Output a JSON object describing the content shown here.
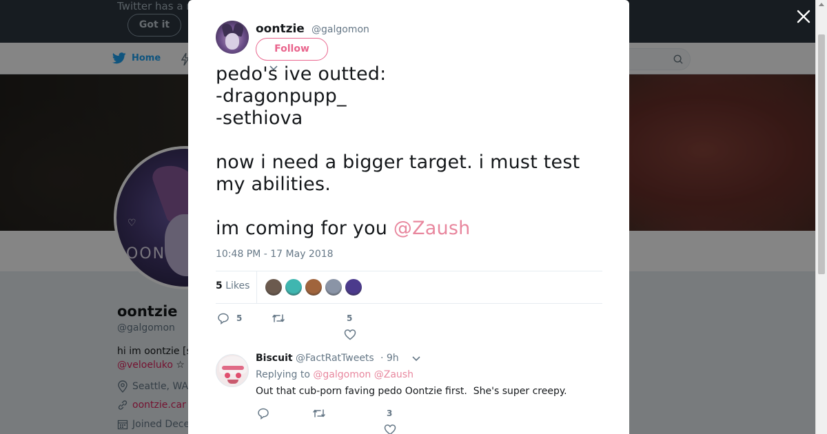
{
  "background": {
    "notice_text": "Twitter has a n",
    "got_it_label": "Got it",
    "nav_home_label": "Home",
    "profile": {
      "name": "oontzie",
      "handle": "@galgomon",
      "bio_line1": "hi im oontzie [s",
      "bio_link": "@veloeluko",
      "bio_star": " ☆ ",
      "location": "Seattle, WA",
      "website": "oontzie.car",
      "joined": "Joined Dece",
      "avatar_text": "OON"
    },
    "avatar_heart": "♡"
  },
  "modal": {
    "author": {
      "name": "oontzie",
      "handle": "@galgomon",
      "follow_label": "Follow"
    },
    "tweet": {
      "text_main": "pedo's ive outted:\n-dragonpupp_\n-sethiova\n\nnow i need a bigger target. i must test\nmy abilities.\n\nim coming for you ",
      "mention": "@Zaush",
      "timestamp": "10:48 PM - 17 May 2018"
    },
    "likes": {
      "count": "5",
      "label": "Likes",
      "liker_colors": [
        "#6b5a4e",
        "#3fb6b0",
        "#a0643c",
        "#8a94a6",
        "#4b3a8c"
      ]
    },
    "actions": {
      "replies": "5",
      "retweets": "",
      "likes": "5"
    },
    "reply": {
      "name": "Biscuit",
      "handle": "@FactRatTweets",
      "time": "· 9h",
      "replying_prefix": "Replying to ",
      "replying_to_1": "@galgomon",
      "replying_to_2": "@Zaush",
      "text": "Out that cub-porn faving pedo Oontzie first.  She's super creepy.",
      "actions": {
        "replies": "",
        "retweets": "",
        "likes": "3"
      }
    }
  },
  "colors": {
    "accent": "#e0245e",
    "mention": "#e8879e",
    "twitter_blue": "#1da1f2",
    "secondary_text": "#657786"
  }
}
